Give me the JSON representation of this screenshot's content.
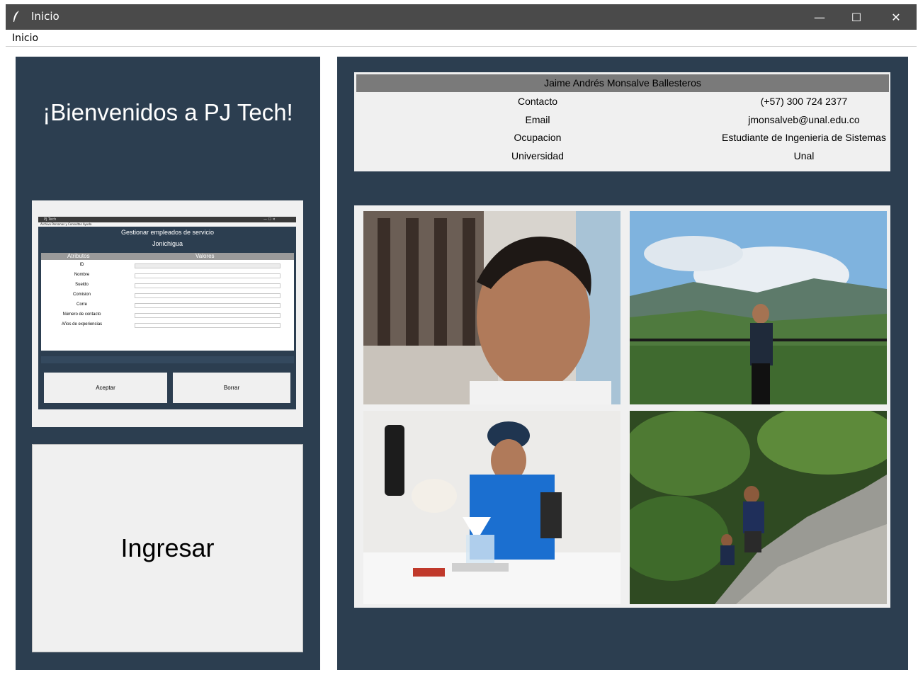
{
  "window": {
    "title": "Inicio",
    "minimize_glyph": "—",
    "maximize_glyph": "☐",
    "close_glyph": "✕"
  },
  "menu": {
    "items": [
      "Inicio"
    ]
  },
  "welcome": {
    "text": "¡Bienvenidos a PJ Tech!"
  },
  "preview": {
    "window_title": "PJ Tech",
    "window_controls": "—  ☐  ✕",
    "menu_items": "Archivo   Personas y Consultas   Ayuda",
    "header_title": "Gestionar empleados de servicio",
    "header_subtitle": "Jonichigua",
    "columns": {
      "attributes": "Atributos",
      "values": "Valores"
    },
    "fields": [
      "ID",
      "Nombre",
      "Sueldo",
      "Comision",
      "Corre",
      "Número de contacto",
      "Años de experiencias"
    ],
    "accept_label": "Aceptar",
    "delete_label": "Borrar"
  },
  "ingresar": {
    "label": "Ingresar"
  },
  "contact": {
    "name": "Jaime Andrés Monsalve Ballesteros",
    "rows": [
      {
        "label": "Contacto",
        "value": "(+57) 300 724 2377"
      },
      {
        "label": "Email",
        "value": "jmonsalveb@unal.edu.co"
      },
      {
        "label": "Ocupacion",
        "value": "Estudiante de Ingenieria de Sistemas"
      },
      {
        "label": "Universidad",
        "value": "Unal"
      }
    ]
  },
  "colors": {
    "panel_bg": "#2c3e50",
    "titlebar_bg": "#4a4a4a",
    "light_bg": "#f0f0f0",
    "contact_header_bg": "#7a7a7a"
  },
  "photos": [
    {
      "icon": "selfie-photo"
    },
    {
      "icon": "mountain-view-photo"
    },
    {
      "icon": "coffee-brewing-photo"
    },
    {
      "icon": "rock-climbing-photo"
    }
  ]
}
